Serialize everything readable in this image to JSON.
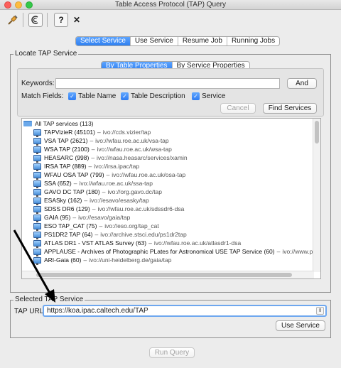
{
  "window": {
    "title": "Table Access Protocol (TAP) Query"
  },
  "toolbar": {
    "icons": [
      "plug-icon",
      "copy-icon",
      "help-icon",
      "close-icon"
    ],
    "help_glyph": "?",
    "close_glyph": "✕"
  },
  "main_tabs": [
    "Select Service",
    "Use Service",
    "Resume Job",
    "Running Jobs"
  ],
  "locate": {
    "title": "Locate TAP Service",
    "subtabs": [
      "By Table Properties",
      "By Service Properties"
    ],
    "keywords_label": "Keywords:",
    "keywords_value": "",
    "and_button": "And",
    "match_label": "Match Fields:",
    "match_fields": [
      "Table Name",
      "Table Description",
      "Service"
    ],
    "cancel_button": "Cancel",
    "find_button": "Find Services"
  },
  "tree": {
    "root": "All TAP services (113)",
    "items": [
      {
        "name": "TAPVizieR (45101)",
        "url": "ivo://cds.vizier/tap"
      },
      {
        "name": "VSA TAP (2621)",
        "url": "ivo://wfau.roe.ac.uk/vsa-tap"
      },
      {
        "name": "WSA TAP (2100)",
        "url": "ivo://wfau.roe.ac.uk/wsa-tap"
      },
      {
        "name": "HEASARC (998)",
        "url": "ivo://nasa.heasarc/services/xamin"
      },
      {
        "name": "IRSA TAP (889)",
        "url": "ivo://irsa.ipac/tap"
      },
      {
        "name": "WFAU OSA TAP (799)",
        "url": "ivo://wfau.roe.ac.uk/osa-tap"
      },
      {
        "name": "SSA (652)",
        "url": "ivo://wfau.roe.ac.uk/ssa-tap"
      },
      {
        "name": "GAVO DC TAP (180)",
        "url": "ivo://org.gavo.dc/tap"
      },
      {
        "name": "ESASky (162)",
        "url": "ivo://esavo/esasky/tap"
      },
      {
        "name": "SDSS DR6 (129)",
        "url": "ivo://wfau.roe.ac.uk/sdssdr6-dsa"
      },
      {
        "name": "GAIA (95)",
        "url": "ivo://esavo/gaia/tap"
      },
      {
        "name": "ESO TAP_CAT (75)",
        "url": "ivo://eso.org/tap_cat"
      },
      {
        "name": "PS1DR2 TAP (64)",
        "url": "ivo://archive.stsci.edu/ps1dr2tap"
      },
      {
        "name": "ATLAS DR1 - VST ATLAS Survey (63)",
        "url": "ivo://wfau.roe.ac.uk/atlasdr1-dsa"
      },
      {
        "name": "APPLAUSE - Archives of Photographic PLates for Astronomical USE  TAP Service (60)",
        "url": "ivo://www.p"
      },
      {
        "name": "ARI-Gaia (60)",
        "url": "ivo://uni-heidelberg.de/gaia/tap"
      }
    ]
  },
  "selected": {
    "title": "Selected TAP Service",
    "url_label": "TAP URL:",
    "url_value": "https://koa.ipac.caltech.edu/TAP",
    "use_button": "Use Service"
  },
  "footer": {
    "run_button": "Run Query"
  }
}
